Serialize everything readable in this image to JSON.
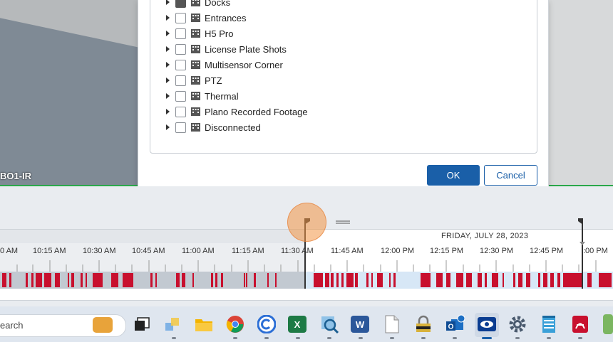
{
  "camera": {
    "label": "BO1-IR"
  },
  "dialog": {
    "tree_items": [
      {
        "label": "Docks"
      },
      {
        "label": "Entrances"
      },
      {
        "label": "H5 Pro"
      },
      {
        "label": "License Plate Shots"
      },
      {
        "label": "Multisensor Corner"
      },
      {
        "label": "PTZ"
      },
      {
        "label": "Thermal"
      },
      {
        "label": "Plano Recorded Footage"
      },
      {
        "label": "Disconnected"
      }
    ],
    "ok_label": "OK",
    "cancel_label": "Cancel"
  },
  "timeline": {
    "date_label": "FRIDAY, JULY 28, 2023",
    "ticks": [
      "0 AM",
      "10:15 AM",
      "10:30 AM",
      "10:45 AM",
      "11:00 AM",
      "11:15 AM",
      "11:30 AM",
      "11:45 AM",
      "12:00 PM",
      "12:15 PM",
      "12:30 PM",
      "12:45 PM",
      ":00 PM"
    ],
    "colors": {
      "recording": "#c8102e",
      "track_past": "#c2c9d1",
      "track_future": "#d7e7f6"
    }
  },
  "taskbar": {
    "search_text": "earch",
    "icons": [
      "briefcase-icon",
      "task-view-icon",
      "widgets-icon",
      "file-explorer-icon",
      "chrome-icon",
      "browser-icon",
      "excel-icon",
      "search-tool-icon",
      "word-icon",
      "document-icon",
      "lock-app-icon",
      "outlook-icon",
      "camera-client-icon",
      "settings-icon",
      "notepad-icon",
      "pdf-icon",
      "green-app-icon"
    ]
  }
}
